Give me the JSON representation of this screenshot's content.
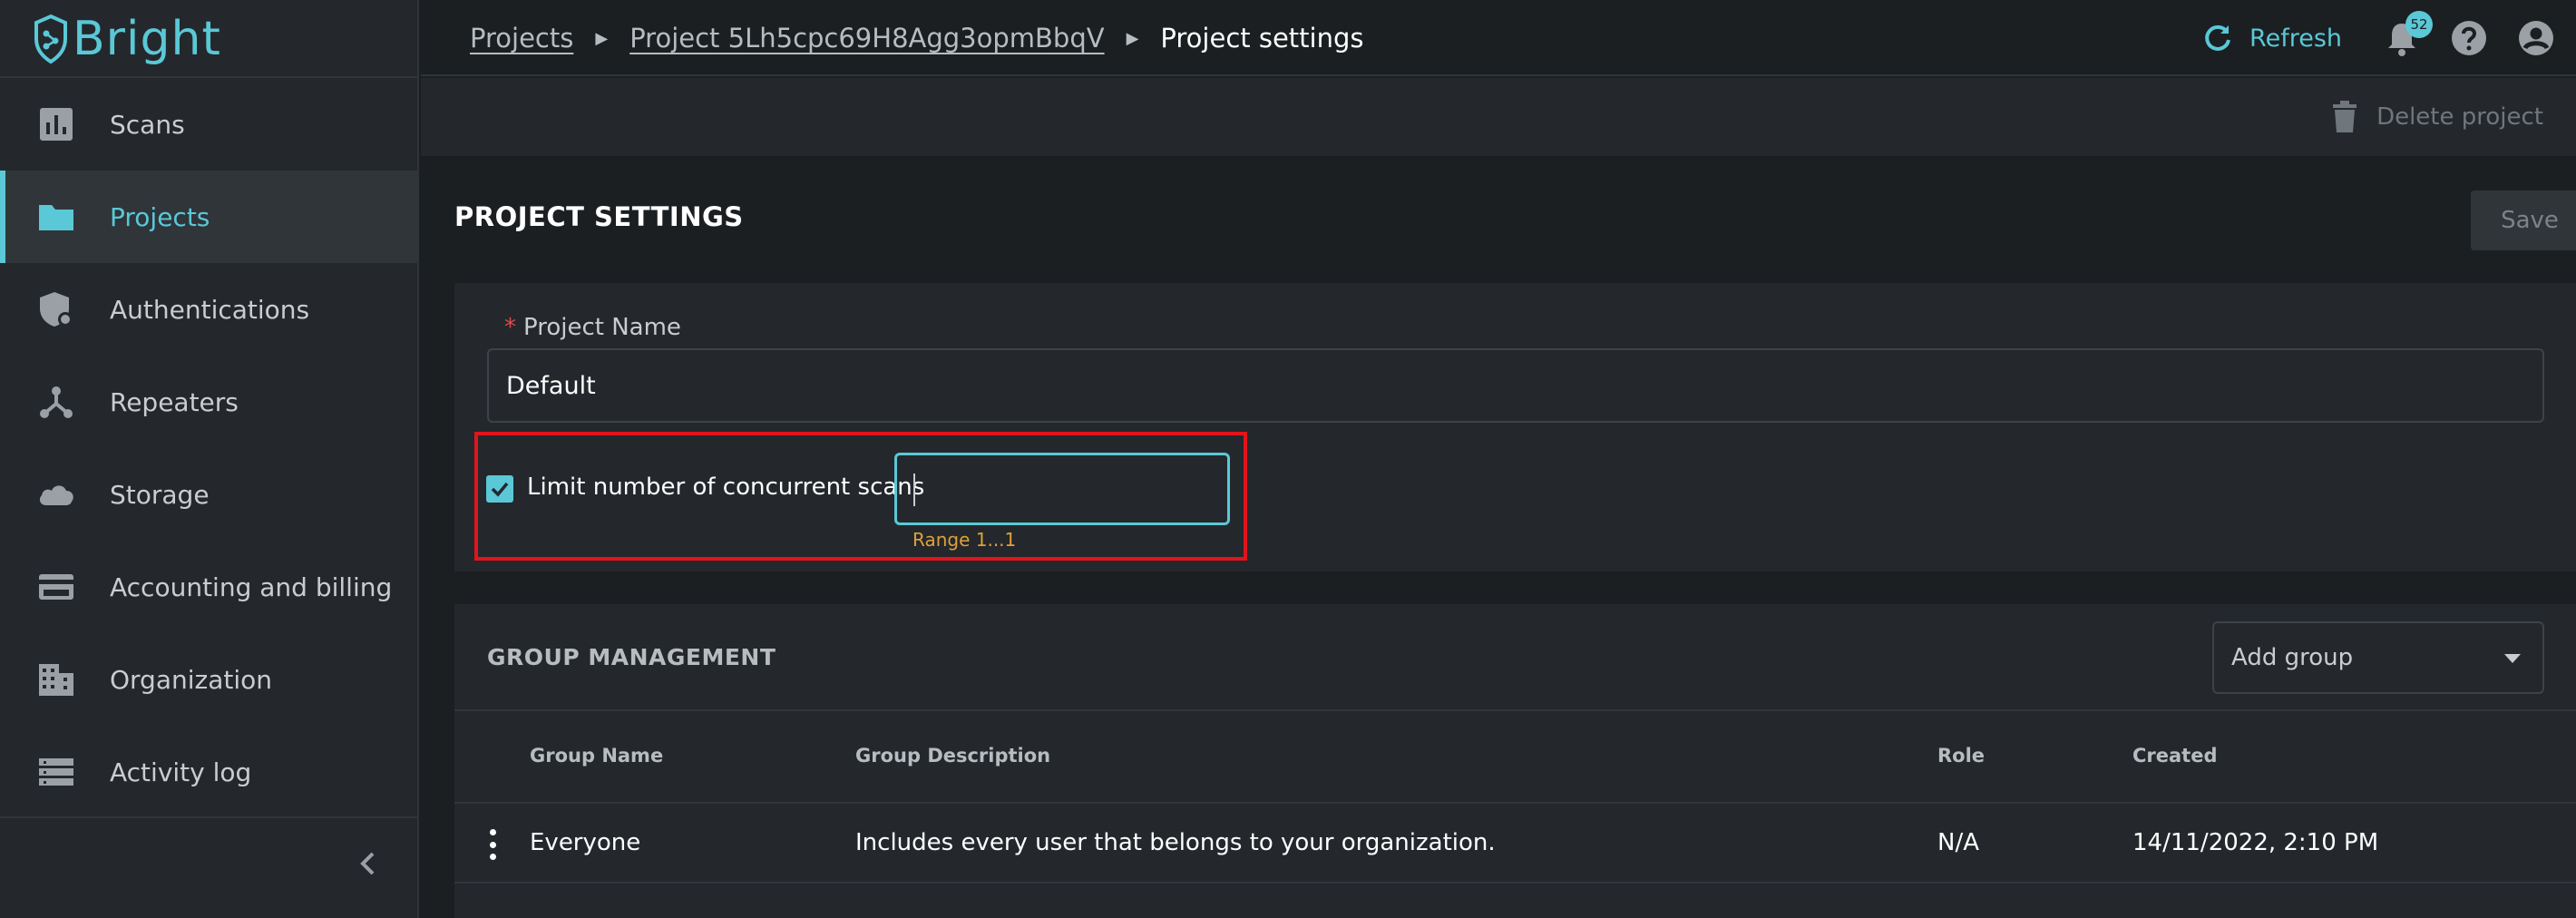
{
  "app": {
    "logo_text": "Bright"
  },
  "sidebar": {
    "items": [
      {
        "label": "Scans",
        "icon": "bar-chart-icon"
      },
      {
        "label": "Projects",
        "icon": "folder-icon",
        "active": true
      },
      {
        "label": "Authentications",
        "icon": "shield-lock-icon"
      },
      {
        "label": "Repeaters",
        "icon": "hub-icon"
      },
      {
        "label": "Storage",
        "icon": "cloud-icon"
      },
      {
        "label": "Accounting and billing",
        "icon": "credit-card-icon"
      },
      {
        "label": "Organization",
        "icon": "building-icon"
      },
      {
        "label": "Activity log",
        "icon": "list-icon"
      }
    ],
    "collapse_icon": "chevron-left-icon"
  },
  "breadcrumb": {
    "root": "Projects",
    "project": "Project 5Lh5cpc69H8Agg3opmBbqV",
    "current": "Project settings"
  },
  "topbar": {
    "refresh_label": "Refresh",
    "notification_count": "52"
  },
  "subheader": {
    "delete_label": "Delete project"
  },
  "settings": {
    "title": "PROJECT SETTINGS",
    "save_label": "Save",
    "name_label": "Project Name",
    "required_mark": "*",
    "name_value": "Default",
    "limit_label": "Limit number of concurrent scans",
    "limit_checked": true,
    "limit_value": "",
    "range_hint": "Range 1...1"
  },
  "groups": {
    "title": "GROUP MANAGEMENT",
    "add_group_placeholder": "Add group",
    "columns": {
      "name": "Group Name",
      "description": "Group Description",
      "role": "Role",
      "created": "Created"
    },
    "rows": [
      {
        "name": "Everyone",
        "description": "Includes every user that belongs to your organization.",
        "role": "N/A",
        "created": "14/11/2022, 2:10 PM"
      }
    ]
  },
  "colors": {
    "accent": "#5ac8d6",
    "background": "#1b1f22",
    "panel": "#24282c",
    "highlight_border": "#e2141b",
    "hint": "#e0a03a",
    "required": "#e4484a"
  }
}
